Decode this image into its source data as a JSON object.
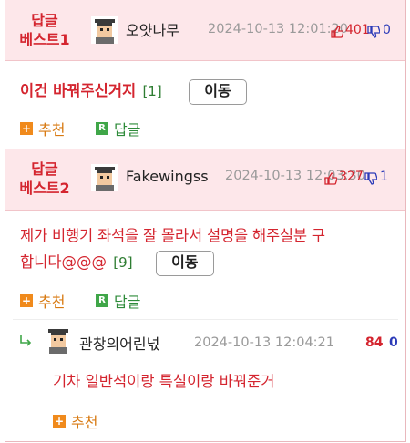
{
  "comments": [
    {
      "badge": "답글\n베스트1",
      "nickname": "오얏나무",
      "date": "2024-10-13 12:01:20",
      "upvotes": "401",
      "downvotes": "0",
      "text": "이건 바꿔주신거지",
      "reply_count": "[1]",
      "move_label": "이동",
      "recommend_label": "추천",
      "reply_label": "답글",
      "plus_glyph": "+",
      "r_glyph": "R"
    },
    {
      "badge": "답글\n베스트2",
      "nickname": "Fakewingss",
      "date": "2024-10-13 12:03:30",
      "upvotes": "327",
      "downvotes": "1",
      "text_line1": "제가 비행기 좌석을 잘 몰라서 설명을 해주실분 구",
      "text_line2": "합니다@@@",
      "reply_count": "[9]",
      "move_label": "이동",
      "recommend_label": "추천",
      "reply_label": "답글",
      "plus_glyph": "+",
      "r_glyph": "R"
    }
  ],
  "reply": {
    "nickname": "관창의어린넋",
    "date": "2024-10-13 12:04:21",
    "upvotes": "84",
    "downvotes": "0",
    "text": "기차 일반석이랑 특실이랑 바꿔준거",
    "recommend_label": "추천",
    "plus_glyph": "+"
  },
  "colors": {
    "accent_red": "#d4252f",
    "header_pink": "#fde7ea",
    "count_green": "#2e7d32",
    "down_blue": "#2b3ab8",
    "recommend_orange": "#f08a1c"
  }
}
